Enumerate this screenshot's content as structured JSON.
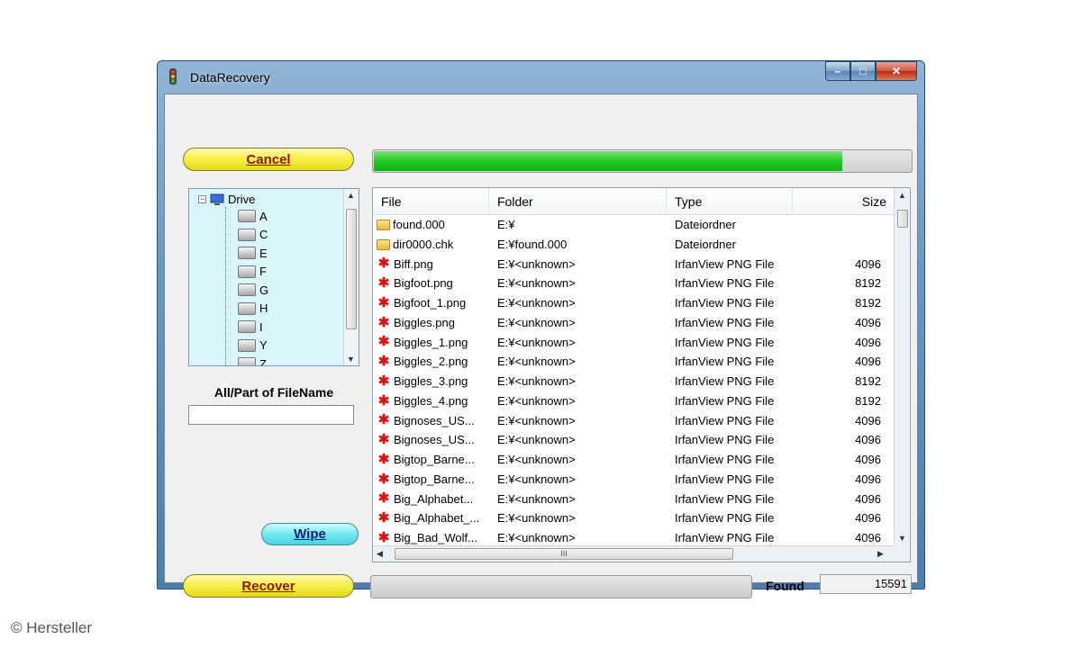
{
  "window": {
    "title": "DataRecovery",
    "controls": {
      "minimize": "–",
      "maximize": "□",
      "close": "✕"
    }
  },
  "buttons": {
    "cancel": "Cancel",
    "wipe": "Wipe",
    "recover": "Recover"
  },
  "progress": {
    "fraction": 0.87
  },
  "tree": {
    "root_label": "Drive",
    "root_expander": "−",
    "drives": [
      "A",
      "C",
      "E",
      "F",
      "G",
      "H",
      "I",
      "Y",
      "Z"
    ]
  },
  "filter": {
    "label": "All/Part of FileName",
    "value": ""
  },
  "list": {
    "columns": [
      "File",
      "Folder",
      "Type",
      "Size"
    ],
    "rows": [
      {
        "icon": "folder-icon",
        "name": "found.000",
        "folder": "E:¥",
        "type": "Dateiordner",
        "size": ""
      },
      {
        "icon": "folder-icon",
        "name": "dir0000.chk",
        "folder": "E:¥found.000",
        "type": "Dateiordner",
        "size": ""
      },
      {
        "icon": "png-icon",
        "name": "Biff.png",
        "folder": "E:¥<unknown>",
        "type": "IrfanView PNG File",
        "size": "4096"
      },
      {
        "icon": "png-icon",
        "name": "Bigfoot.png",
        "folder": "E:¥<unknown>",
        "type": "IrfanView PNG File",
        "size": "8192"
      },
      {
        "icon": "png-icon",
        "name": "Bigfoot_1.png",
        "folder": "E:¥<unknown>",
        "type": "IrfanView PNG File",
        "size": "8192"
      },
      {
        "icon": "png-icon",
        "name": "Biggles.png",
        "folder": "E:¥<unknown>",
        "type": "IrfanView PNG File",
        "size": "4096"
      },
      {
        "icon": "png-icon",
        "name": "Biggles_1.png",
        "folder": "E:¥<unknown>",
        "type": "IrfanView PNG File",
        "size": "4096"
      },
      {
        "icon": "png-icon",
        "name": "Biggles_2.png",
        "folder": "E:¥<unknown>",
        "type": "IrfanView PNG File",
        "size": "4096"
      },
      {
        "icon": "png-icon",
        "name": "Biggles_3.png",
        "folder": "E:¥<unknown>",
        "type": "IrfanView PNG File",
        "size": "8192"
      },
      {
        "icon": "png-icon",
        "name": "Biggles_4.png",
        "folder": "E:¥<unknown>",
        "type": "IrfanView PNG File",
        "size": "8192"
      },
      {
        "icon": "png-icon",
        "name": "Bignoses_US...",
        "folder": "E:¥<unknown>",
        "type": "IrfanView PNG File",
        "size": "4096"
      },
      {
        "icon": "png-icon",
        "name": "Bignoses_US...",
        "folder": "E:¥<unknown>",
        "type": "IrfanView PNG File",
        "size": "4096"
      },
      {
        "icon": "png-icon",
        "name": "Bigtop_Barne...",
        "folder": "E:¥<unknown>",
        "type": "IrfanView PNG File",
        "size": "4096"
      },
      {
        "icon": "png-icon",
        "name": "Bigtop_Barne...",
        "folder": "E:¥<unknown>",
        "type": "IrfanView PNG File",
        "size": "4096"
      },
      {
        "icon": "png-icon",
        "name": "Big_Alphabet...",
        "folder": "E:¥<unknown>",
        "type": "IrfanView PNG File",
        "size": "4096"
      },
      {
        "icon": "png-icon",
        "name": "Big_Alphabet_...",
        "folder": "E:¥<unknown>",
        "type": "IrfanView PNG File",
        "size": "4096"
      },
      {
        "icon": "png-icon",
        "name": "Big_Bad_Wolf...",
        "folder": "E:¥<unknown>",
        "type": "IrfanView PNG File",
        "size": "4096"
      }
    ],
    "hscroll_grip": "III"
  },
  "status": {
    "found_label": "Found",
    "found_value": "15591"
  },
  "credit": "© Hersteller",
  "colors": {
    "progress": "#1ecb1e",
    "tree_bg": "#d9f6fb",
    "cancel_button": "#f5ec3b",
    "wipe_button": "#6fe6f0"
  }
}
